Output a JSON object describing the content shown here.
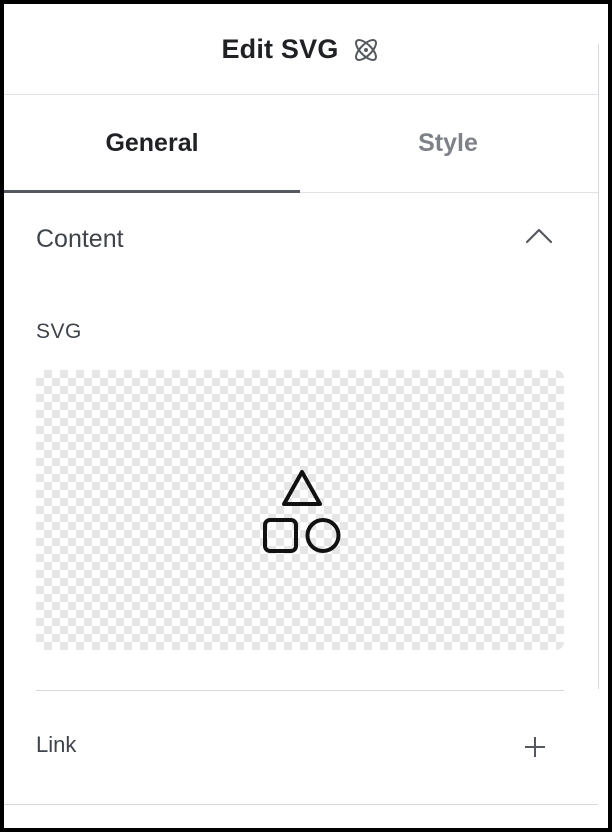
{
  "header": {
    "title": "Edit SVG",
    "icon": "atom-icon"
  },
  "tabs": [
    {
      "label": "General",
      "active": true
    },
    {
      "label": "Style",
      "active": false
    }
  ],
  "section": {
    "title": "Content",
    "expanded": true,
    "toggle_icon": "chevron-up-icon"
  },
  "svg_field": {
    "label": "SVG",
    "preview_icon": "shapes-icon"
  },
  "link_field": {
    "label": "Link",
    "action_icon": "plus-icon"
  },
  "colors": {
    "text_primary": "#1f2124",
    "text_secondary": "#7e8288",
    "divider": "#d5d8dc",
    "tab_indicator": "#55595f"
  }
}
